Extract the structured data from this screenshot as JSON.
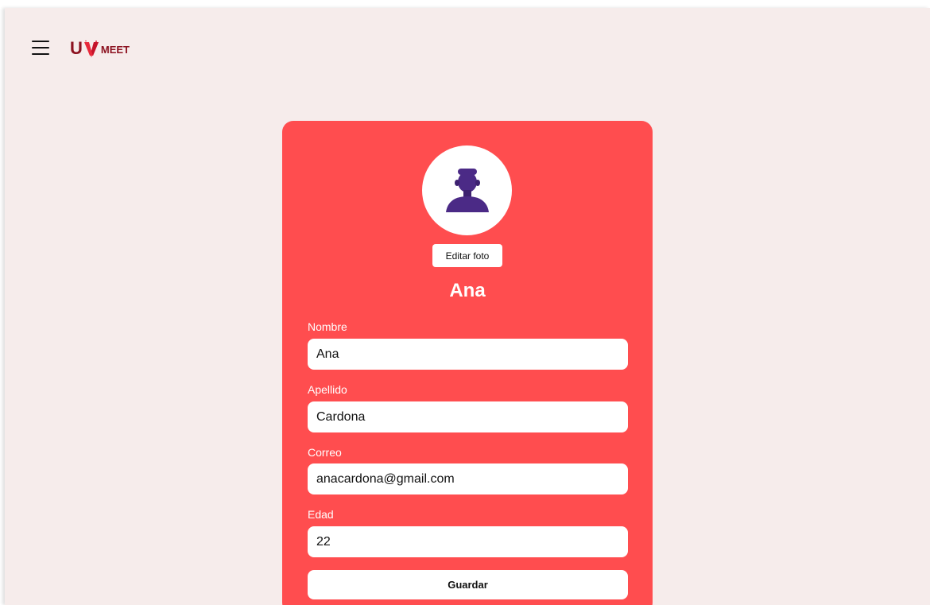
{
  "header": {
    "menu_icon": "hamburger-menu-icon",
    "logo": {
      "text_u": "U",
      "text_meet": "MEET",
      "color": "#8c1220"
    }
  },
  "profile": {
    "avatar_icon": "user-avatar-icon",
    "edit_photo_label": "Editar foto",
    "display_name": "Ana",
    "card_color": "#ff4d4f",
    "fields": {
      "nombre": {
        "label": "Nombre",
        "value": "Ana"
      },
      "apellido": {
        "label": "Apellido",
        "value": "Cardona"
      },
      "correo": {
        "label": "Correo",
        "value": "anacardona@gmail.com"
      },
      "edad": {
        "label": "Edad",
        "value": "22"
      }
    },
    "save_label": "Guardar"
  },
  "theme": {
    "background": "#f6eceb",
    "avatar_color": "#4b2a86"
  }
}
